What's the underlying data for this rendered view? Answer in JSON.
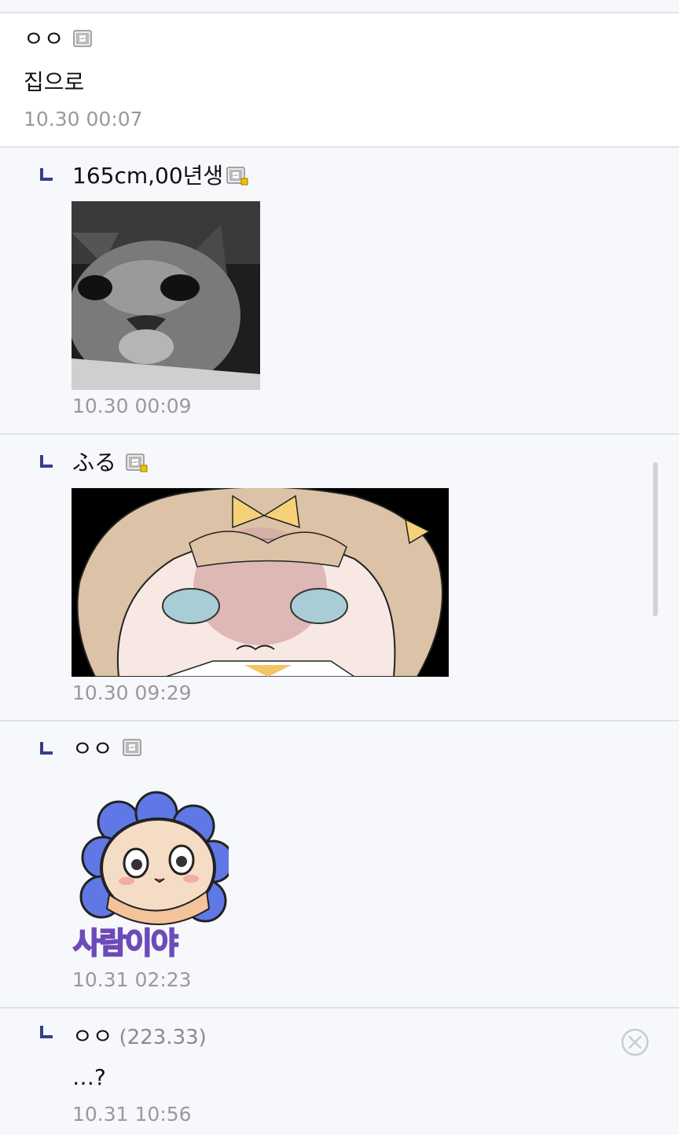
{
  "comments": [
    {
      "nickname": "ㅇㅇ",
      "text": "집으로",
      "time": "10.30 00:07",
      "badge": "fixed-nick-icon"
    },
    {
      "nickname": "165cm,00년생",
      "time": "10.30 00:09",
      "badge": "fixed-nick-sub-icon",
      "image": "grayscale cat photo",
      "is_reply": true
    },
    {
      "nickname": "ふる",
      "time": "10.30 09:29",
      "badge": "fixed-nick-sub-icon",
      "image": "anime girl drawing",
      "is_reply": true
    },
    {
      "nickname": "ㅇㅇ",
      "time": "10.31 02:23",
      "badge": "fixed-nick-icon",
      "sticker_text": "사람이야",
      "is_reply": true
    },
    {
      "nickname": "ㅇㅇ",
      "ip": "(223.33)",
      "text": "…?",
      "time": "10.31 10:56",
      "is_reply": true,
      "delete_icon": "close-circle-icon"
    }
  ],
  "colors": {
    "reply_arrow": "#34408a",
    "time": "#9a9a9a",
    "divider": "#dfe2ea",
    "reply_bg": "#f7f8fb",
    "sticker_flower": "#5f78e6"
  }
}
